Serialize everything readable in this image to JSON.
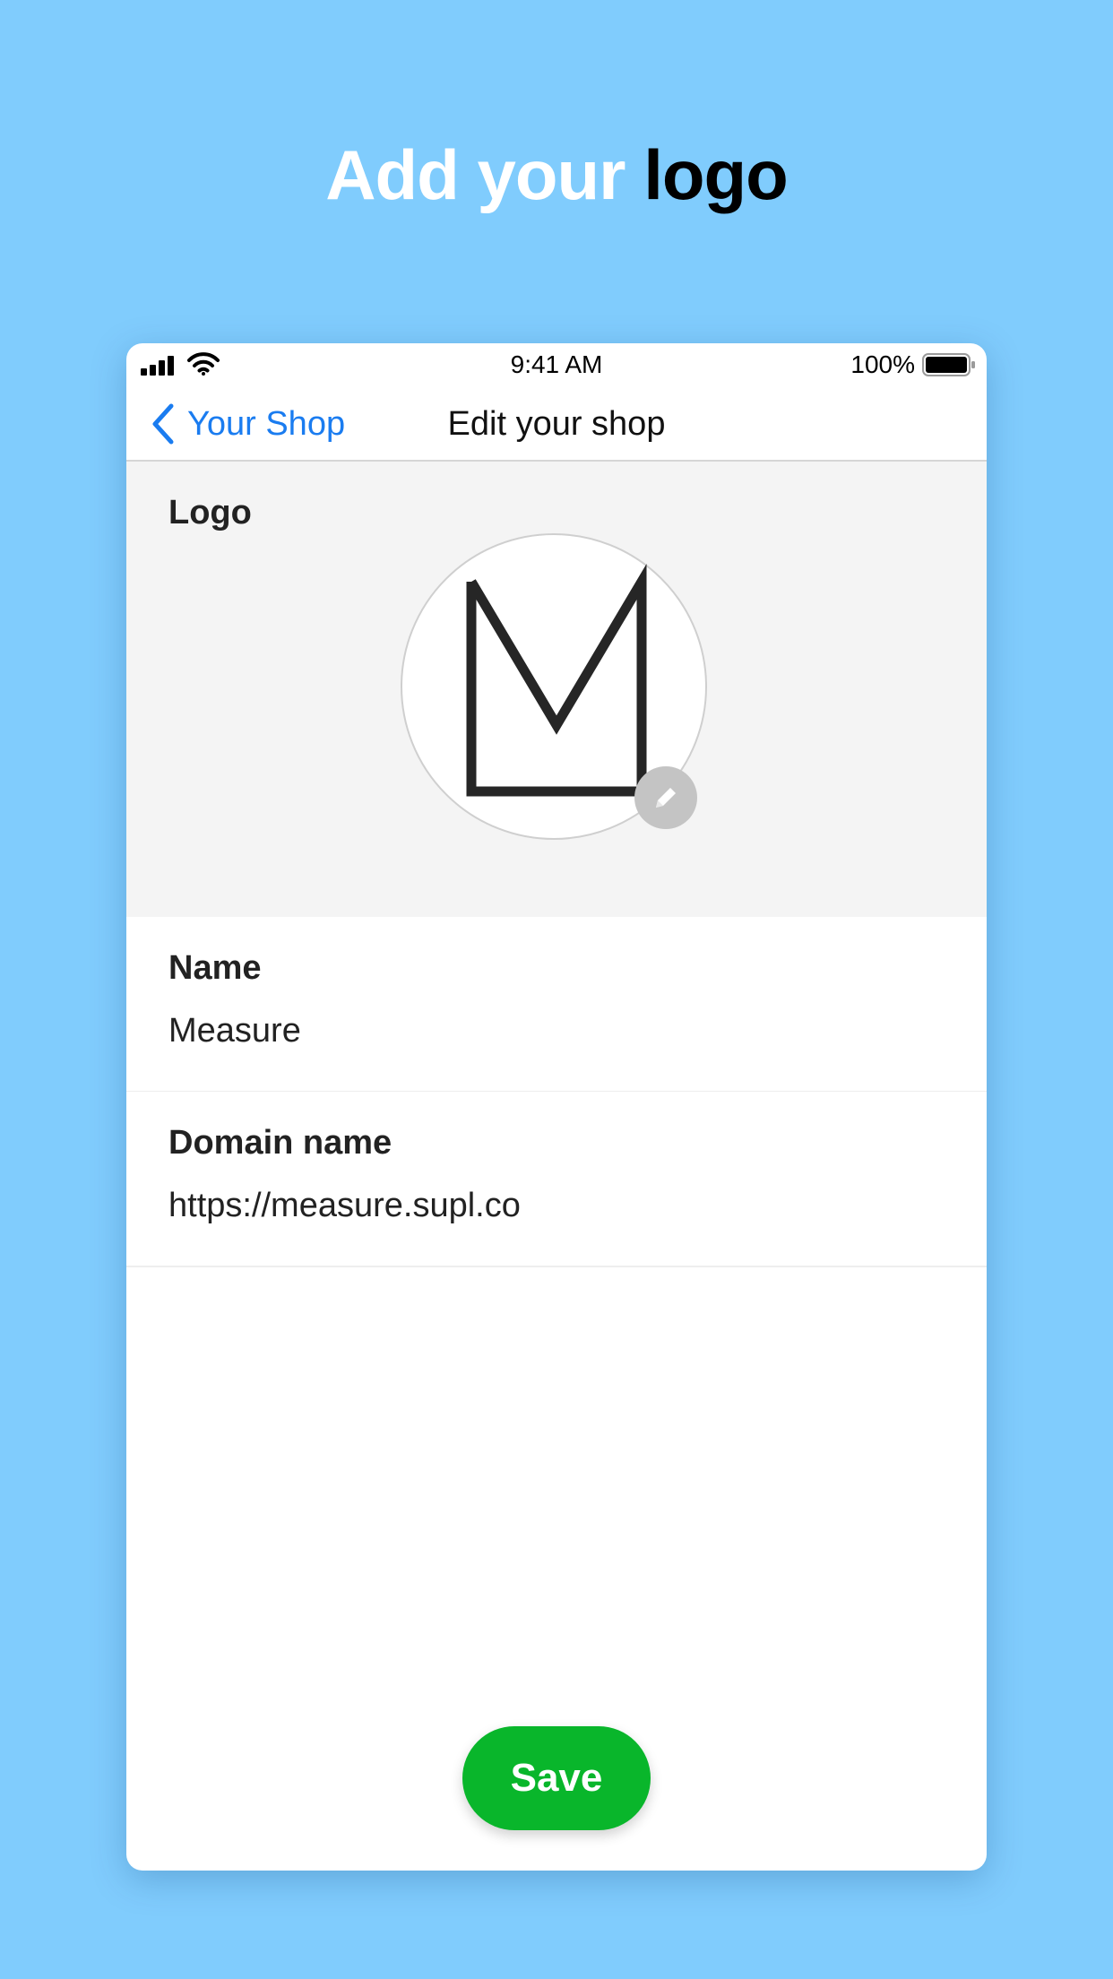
{
  "headline": {
    "part1": "Add your",
    "part2": "logo"
  },
  "status_bar": {
    "time": "9:41 AM",
    "battery": "100%"
  },
  "nav": {
    "back_label": "Your Shop",
    "title": "Edit your shop"
  },
  "logo_section": {
    "label": "Logo",
    "logo_icon": "letter-m-logo",
    "edit_icon": "pencil-icon"
  },
  "fields": {
    "name": {
      "label": "Name",
      "value": "Measure"
    },
    "domain": {
      "label": "Domain name",
      "value": "https://measure.supl.co"
    }
  },
  "actions": {
    "save_label": "Save"
  },
  "colors": {
    "background": "#80ccfd",
    "accent_link": "#1a7cf0",
    "save_button": "#09b62b",
    "logo_section_bg": "#f4f4f4"
  }
}
